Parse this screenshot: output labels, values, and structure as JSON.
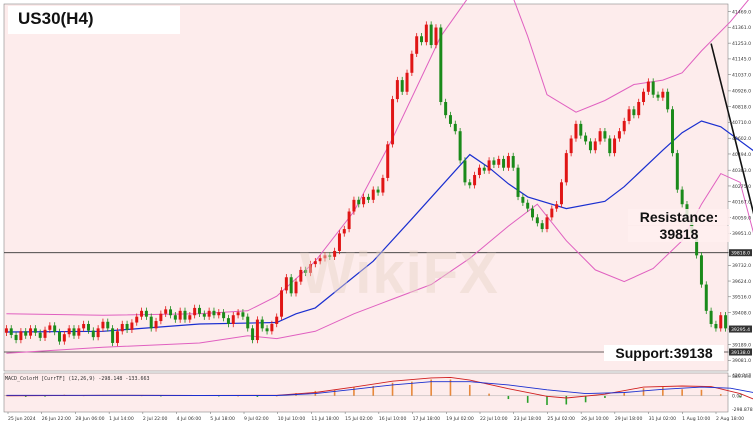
{
  "title": "US30(H4)",
  "watermark": "WikiFX",
  "annotations": {
    "resistance_line1": "Resistance:",
    "resistance_line2": "39818",
    "support": "Support:39138"
  },
  "indicator_label": "MACD_ColorH [CurrTF] (12,26,9) -298.148 -133.663",
  "colors": {
    "background": "#fdecec",
    "bull_candle": "#e01515",
    "bear_candle": "#1a8a1a",
    "bollinger": "#e060c0",
    "moving_average": "#1a2fd0",
    "trend_arrow": "#111111"
  },
  "chart_data": [
    {
      "type": "candlestick",
      "title": "US30(H4)",
      "ylim": [
        39008,
        41521
      ],
      "y_ticks": [
        41469.0,
        41361.0,
        41253.0,
        41145.0,
        41037.0,
        40926.0,
        40818.0,
        40710.0,
        40602.0,
        40494.0,
        40383.0,
        40275.0,
        40167.0,
        40059.0,
        39951.0,
        39818.0,
        39732.0,
        39624.0,
        39516.0,
        39408.0,
        39295.4,
        39189.0,
        39138.0,
        39081.0,
        38973.0
      ],
      "y_tick_labels": [
        "41469.0",
        "41361.0",
        "41253.0",
        "41145.0",
        "41037.0",
        "40926.0",
        "40818.0",
        "40710.0",
        "40602.0",
        "40494.0",
        "40383.0",
        "40275.0",
        "40167.0",
        "40059.0",
        "39951.0",
        "39818.0",
        "39732.0",
        "39624.0",
        "39516.0",
        "39408.0",
        "39295.4",
        "39189.0",
        "39138.0",
        "39081.0",
        "38973.0"
      ],
      "x_tick_labels": [
        "25 Jun 2024",
        "26 Jun 22:00",
        "28 Jun 06:00",
        "1 Jul 14:00",
        "2 Jul 22:00",
        "4 Jul 06:00",
        "5 Jul 18:00",
        "9 Jul 02:00",
        "10 Jul 10:00",
        "11 Jul 18:00",
        "15 Jul 02:00",
        "16 Jul 10:00",
        "17 Jul 18:00",
        "19 Jul 02:00",
        "22 Jul 10:00",
        "23 Jul 18:00",
        "25 Jul 02:00",
        "26 Jul 10:00",
        "29 Jul 18:00",
        "31 Jul 02:00",
        "1 Aug 10:00",
        "2 Aug 18:00"
      ],
      "horizontal_lines": [
        {
          "label": "Resistance",
          "value": 39818
        },
        {
          "label": "Support",
          "value": 39138
        }
      ],
      "current_price": 39295.4,
      "candles": [
        [
          39270,
          39300
        ],
        [
          39300,
          39255
        ],
        [
          39255,
          39220
        ],
        [
          39220,
          39280
        ],
        [
          39280,
          39250
        ],
        [
          39250,
          39300
        ],
        [
          39300,
          39270
        ],
        [
          39270,
          39235
        ],
        [
          39235,
          39290
        ],
        [
          39290,
          39320
        ],
        [
          39320,
          39275
        ],
        [
          39275,
          39210
        ],
        [
          39210,
          39260
        ],
        [
          39260,
          39300
        ],
        [
          39300,
          39250
        ],
        [
          39250,
          39300
        ],
        [
          39300,
          39330
        ],
        [
          39330,
          39285
        ],
        [
          39285,
          39240
        ],
        [
          39240,
          39300
        ],
        [
          39300,
          39345
        ],
        [
          39345,
          39300
        ],
        [
          39300,
          39200
        ],
        [
          39200,
          39280
        ],
        [
          39280,
          39330
        ],
        [
          39330,
          39290
        ],
        [
          39290,
          39340
        ],
        [
          39340,
          39380
        ],
        [
          39380,
          39420
        ],
        [
          39420,
          39380
        ],
        [
          39380,
          39300
        ],
        [
          39300,
          39350
        ],
        [
          39350,
          39400
        ],
        [
          39400,
          39430
        ],
        [
          39430,
          39390
        ],
        [
          39390,
          39360
        ],
        [
          39360,
          39420
        ],
        [
          39420,
          39360
        ],
        [
          39360,
          39390
        ],
        [
          39390,
          39440
        ],
        [
          39440,
          39400
        ],
        [
          39400,
          39380
        ],
        [
          39380,
          39420
        ],
        [
          39420,
          39390
        ],
        [
          39390,
          39410
        ],
        [
          39410,
          39370
        ],
        [
          39370,
          39330
        ],
        [
          39330,
          39390
        ],
        [
          39390,
          39410
        ],
        [
          39410,
          39380
        ],
        [
          39380,
          39300
        ],
        [
          39300,
          39220
        ],
        [
          39220,
          39360
        ],
        [
          39360,
          39300
        ],
        [
          39300,
          39280
        ],
        [
          39280,
          39330
        ],
        [
          39330,
          39380
        ],
        [
          39380,
          39560
        ],
        [
          39560,
          39650
        ],
        [
          39650,
          39540
        ],
        [
          39540,
          39620
        ],
        [
          39620,
          39700
        ],
        [
          39700,
          39680
        ],
        [
          39680,
          39740
        ],
        [
          39740,
          39760
        ],
        [
          39760,
          39780
        ],
        [
          39780,
          39800
        ],
        [
          39800,
          39790
        ],
        [
          39790,
          39830
        ],
        [
          39830,
          39950
        ],
        [
          39950,
          39980
        ],
        [
          39980,
          40100
        ],
        [
          40100,
          40180
        ],
        [
          40180,
          40150
        ],
        [
          40150,
          40200
        ],
        [
          40200,
          40180
        ],
        [
          40180,
          40250
        ],
        [
          40250,
          40230
        ],
        [
          40230,
          40330
        ],
        [
          40330,
          40560
        ],
        [
          40560,
          40870
        ],
        [
          40870,
          41000
        ],
        [
          41000,
          40920
        ],
        [
          40920,
          41050
        ],
        [
          41050,
          41180
        ],
        [
          41180,
          41300
        ],
        [
          41300,
          41260
        ],
        [
          41260,
          41380
        ],
        [
          41380,
          41240
        ],
        [
          41240,
          41360
        ],
        [
          41360,
          40850
        ],
        [
          40850,
          40760
        ],
        [
          40760,
          40700
        ],
        [
          40700,
          40650
        ],
        [
          40650,
          40450
        ],
        [
          40450,
          40300
        ],
        [
          40300,
          40280
        ],
        [
          40280,
          40350
        ],
        [
          40350,
          40400
        ],
        [
          40400,
          40380
        ],
        [
          40380,
          40450
        ],
        [
          40450,
          40420
        ],
        [
          40420,
          40460
        ],
        [
          40460,
          40400
        ],
        [
          40400,
          40480
        ],
        [
          40480,
          40400
        ],
        [
          40400,
          40200
        ],
        [
          40200,
          40160
        ],
        [
          40160,
          40120
        ],
        [
          40120,
          40060
        ],
        [
          40060,
          40020
        ],
        [
          40020,
          39980
        ],
        [
          39980,
          40060
        ],
        [
          40060,
          40120
        ],
        [
          40120,
          40150
        ],
        [
          40150,
          40300
        ],
        [
          40300,
          40500
        ],
        [
          40500,
          40600
        ],
        [
          40600,
          40700
        ],
        [
          40700,
          40620
        ],
        [
          40620,
          40580
        ],
        [
          40580,
          40520
        ],
        [
          40520,
          40580
        ],
        [
          40580,
          40650
        ],
        [
          40650,
          40600
        ],
        [
          40600,
          40500
        ],
        [
          40500,
          40600
        ],
        [
          40600,
          40650
        ],
        [
          40650,
          40720
        ],
        [
          40720,
          40800
        ],
        [
          40800,
          40760
        ],
        [
          40760,
          40850
        ],
        [
          40850,
          40920
        ],
        [
          40920,
          40990
        ],
        [
          40990,
          40900
        ],
        [
          40900,
          40880
        ],
        [
          40880,
          40920
        ],
        [
          40920,
          40800
        ],
        [
          40800,
          40500
        ],
        [
          40500,
          40250
        ],
        [
          40250,
          40150
        ],
        [
          40150,
          40050
        ],
        [
          40050,
          39950
        ],
        [
          39950,
          39800
        ],
        [
          39800,
          39600
        ],
        [
          39600,
          39420
        ],
        [
          39420,
          39330
        ],
        [
          39330,
          39300
        ],
        [
          39300,
          39390
        ],
        [
          39390,
          39300
        ]
      ],
      "moving_average": [
        [
          0,
          39275
        ],
        [
          20,
          39280
        ],
        [
          40,
          39330
        ],
        [
          56,
          39340
        ],
        [
          60,
          39400
        ],
        [
          64,
          39440
        ],
        [
          76,
          39760
        ],
        [
          84,
          40050
        ],
        [
          96,
          40490
        ],
        [
          100,
          40400
        ],
        [
          104,
          40290
        ],
        [
          108,
          40200
        ],
        [
          116,
          40120
        ],
        [
          124,
          40170
        ],
        [
          128,
          40270
        ],
        [
          136,
          40520
        ],
        [
          140,
          40640
        ],
        [
          144,
          40720
        ],
        [
          148,
          40680
        ],
        [
          160,
          40390
        ]
      ],
      "bollinger_upper": [
        [
          0,
          39400
        ],
        [
          20,
          39390
        ],
        [
          40,
          39400
        ],
        [
          50,
          39420
        ],
        [
          56,
          39520
        ],
        [
          64,
          39760
        ],
        [
          72,
          40100
        ],
        [
          80,
          40600
        ],
        [
          90,
          41300
        ],
        [
          96,
          41580
        ],
        [
          104,
          41650
        ],
        [
          108,
          41300
        ],
        [
          112,
          40900
        ],
        [
          118,
          40780
        ],
        [
          124,
          40860
        ],
        [
          130,
          40970
        ],
        [
          136,
          41000
        ],
        [
          140,
          41050
        ],
        [
          144,
          41200
        ],
        [
          150,
          41400
        ],
        [
          156,
          41640
        ]
      ],
      "bollinger_lower": [
        [
          0,
          39130
        ],
        [
          20,
          39170
        ],
        [
          40,
          39200
        ],
        [
          50,
          39250
        ],
        [
          56,
          39230
        ],
        [
          64,
          39280
        ],
        [
          72,
          39400
        ],
        [
          80,
          39500
        ],
        [
          88,
          39600
        ],
        [
          96,
          39780
        ],
        [
          104,
          40000
        ],
        [
          110,
          40150
        ],
        [
          116,
          39900
        ],
        [
          122,
          39700
        ],
        [
          128,
          39620
        ],
        [
          134,
          39710
        ],
        [
          140,
          39900
        ],
        [
          144,
          40150
        ],
        [
          148,
          40360
        ],
        [
          152,
          40300
        ],
        [
          156,
          39800
        ],
        [
          160,
          39380
        ]
      ],
      "trend_arrow": {
        "from": [
          146,
          41250
        ],
        "to": [
          160,
          39400
        ]
      }
    },
    {
      "type": "histogram",
      "title": "MACD_ColorH [CurrTF] (12,26,9) -298.148 -133.663",
      "y_tick_labels": [
        "420.347",
        "0.00",
        "-298.878"
      ],
      "ylim": [
        -298.878,
        420.347
      ],
      "histogram": [
        [
          0,
          10
        ],
        [
          4,
          -20
        ],
        [
          8,
          -15
        ],
        [
          12,
          20
        ],
        [
          16,
          5
        ],
        [
          20,
          15
        ],
        [
          24,
          10
        ],
        [
          28,
          5
        ],
        [
          32,
          -5
        ],
        [
          36,
          15
        ],
        [
          40,
          10
        ],
        [
          44,
          -5
        ],
        [
          48,
          0
        ],
        [
          52,
          -20
        ],
        [
          56,
          0
        ],
        [
          60,
          50
        ],
        [
          64,
          90
        ],
        [
          68,
          110
        ],
        [
          72,
          160
        ],
        [
          76,
          180
        ],
        [
          80,
          240
        ],
        [
          84,
          260
        ],
        [
          88,
          300
        ],
        [
          92,
          300
        ],
        [
          96,
          200
        ],
        [
          100,
          40
        ],
        [
          104,
          -60
        ],
        [
          108,
          -130
        ],
        [
          112,
          -170
        ],
        [
          116,
          -160
        ],
        [
          120,
          -120
        ],
        [
          124,
          -40
        ],
        [
          128,
          60
        ],
        [
          132,
          140
        ],
        [
          136,
          160
        ],
        [
          140,
          120
        ],
        [
          144,
          110
        ],
        [
          148,
          30
        ],
        [
          152,
          -30
        ],
        [
          156,
          -190
        ],
        [
          160,
          -270
        ]
      ],
      "macd_line": [
        [
          0,
          0
        ],
        [
          20,
          10
        ],
        [
          40,
          5
        ],
        [
          56,
          10
        ],
        [
          64,
          60
        ],
        [
          72,
          160
        ],
        [
          80,
          270
        ],
        [
          88,
          330
        ],
        [
          92,
          340
        ],
        [
          96,
          290
        ],
        [
          104,
          130
        ],
        [
          112,
          -10
        ],
        [
          116,
          -40
        ],
        [
          124,
          30
        ],
        [
          132,
          160
        ],
        [
          140,
          180
        ],
        [
          146,
          170
        ],
        [
          152,
          40
        ],
        [
          160,
          -250
        ]
      ],
      "signal_line": [
        [
          0,
          10
        ],
        [
          20,
          10
        ],
        [
          40,
          5
        ],
        [
          56,
          5
        ],
        [
          64,
          40
        ],
        [
          72,
          120
        ],
        [
          80,
          200
        ],
        [
          88,
          260
        ],
        [
          96,
          260
        ],
        [
          104,
          200
        ],
        [
          112,
          110
        ],
        [
          120,
          40
        ],
        [
          128,
          60
        ],
        [
          136,
          120
        ],
        [
          144,
          160
        ],
        [
          150,
          140
        ],
        [
          156,
          40
        ],
        [
          160,
          -130
        ]
      ]
    }
  ]
}
